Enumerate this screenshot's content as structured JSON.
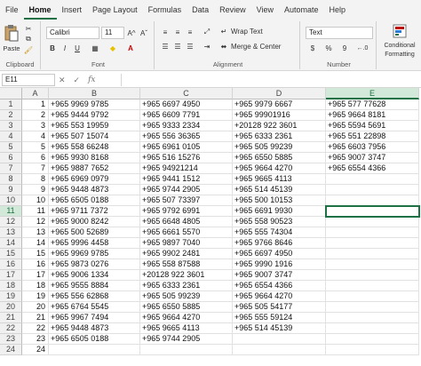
{
  "tabs": [
    "File",
    "Home",
    "Insert",
    "Page Layout",
    "Formulas",
    "Data",
    "Review",
    "View",
    "Automate",
    "Help"
  ],
  "active_tab": "Home",
  "ribbon": {
    "clipboard": {
      "paste": "Paste",
      "label": "Clipboard"
    },
    "font": {
      "name": "Calibri",
      "size": "11",
      "grow": "A^",
      "shrink": "Aˇ",
      "bold": "B",
      "italic": "I",
      "underline": "U",
      "label": "Font"
    },
    "alignment": {
      "wrap": "Wrap Text",
      "merge": "Merge & Center",
      "label": "Alignment"
    },
    "number": {
      "format": "Text",
      "currency": "$",
      "percent": "%",
      "comma": "9",
      "label": "Number"
    },
    "styles": {
      "conditional": "Conditional",
      "formatting": "Formatting"
    }
  },
  "formula_bar": {
    "name_box": "E11",
    "fx": "fx",
    "value": ""
  },
  "columns": [
    "A",
    "B",
    "C",
    "D",
    "E"
  ],
  "selected_column": "E",
  "selected_row": 11,
  "rows": [
    {
      "n": "1",
      "a": "1",
      "b": "+965 9969 9785",
      "c": "+965 6697 4950",
      "d": "+965 9979 6667",
      "e": "+965 577 77628"
    },
    {
      "n": "2",
      "a": "2",
      "b": "+965 9444 9792",
      "c": "+965 6609 7791",
      "d": "+965 99901916",
      "e": "+965 9664 8181"
    },
    {
      "n": "3",
      "a": "3",
      "b": "+965 553 19959",
      "c": "+965 9333 2334",
      "d": "+20128 922 3601",
      "e": "+965 5594 5691"
    },
    {
      "n": "4",
      "a": "4",
      "b": "+965 507 15074",
      "c": "+965 556 36365",
      "d": "+965 6333 2361",
      "e": "+965 551 22898"
    },
    {
      "n": "5",
      "a": "5",
      "b": "+965 558 66248",
      "c": "+965 6961 0105",
      "d": "+965 505 99239",
      "e": "+965 6603 7956"
    },
    {
      "n": "6",
      "a": "6",
      "b": "+965 9930 8168",
      "c": "+965 516 15276",
      "d": "+965 6550 5885",
      "e": "+965 9007 3747"
    },
    {
      "n": "7",
      "a": "7",
      "b": "+965 9887 7652",
      "c": "+965 94921214",
      "d": "+965 9664 4270",
      "e": "+965 6554 4366"
    },
    {
      "n": "8",
      "a": "8",
      "b": "+965 6969 0979",
      "c": "+965 9441 1512",
      "d": "+965 9665 4113",
      "e": ""
    },
    {
      "n": "9",
      "a": "9",
      "b": "+965 9448 4873",
      "c": "+965 9744 2905",
      "d": "+965 514 45139",
      "e": ""
    },
    {
      "n": "10",
      "a": "10",
      "b": "+965 6505 0188",
      "c": "+965 507 73397",
      "d": "+965 500 10153",
      "e": ""
    },
    {
      "n": "11",
      "a": "11",
      "b": "+965 9711 7372",
      "c": "+965 9792 6991",
      "d": "+965 6691 9930",
      "e": ""
    },
    {
      "n": "12",
      "a": "12",
      "b": "+965 9000 8242",
      "c": "+965 6648 4805",
      "d": "+965 558 90523",
      "e": ""
    },
    {
      "n": "13",
      "a": "13",
      "b": "+965 500 52689",
      "c": "+965 6661 5570",
      "d": "+965 555 74304",
      "e": ""
    },
    {
      "n": "14",
      "a": "14",
      "b": "+965 9996 4458",
      "c": "+965 9897 7040",
      "d": "+965 9766 8646",
      "e": ""
    },
    {
      "n": "15",
      "a": "15",
      "b": "+965 9969 9785",
      "c": "+965 9902 2481",
      "d": "+965 6697 4950",
      "e": ""
    },
    {
      "n": "16",
      "a": "16",
      "b": "+965 9873 0276",
      "c": "+965 558 87588",
      "d": "+965 9990 1916",
      "e": ""
    },
    {
      "n": "17",
      "a": "17",
      "b": "+965 9006 1334",
      "c": "+20128 922 3601",
      "d": "+965 9007 3747",
      "e": ""
    },
    {
      "n": "18",
      "a": "18",
      "b": "+965 9555 8884",
      "c": "+965 6333 2361",
      "d": "+965 6554 4366",
      "e": ""
    },
    {
      "n": "19",
      "a": "19",
      "b": "+965 556 62868",
      "c": "+965 505 99239",
      "d": "+965 9664 4270",
      "e": ""
    },
    {
      "n": "20",
      "a": "20",
      "b": "+965 6764 5545",
      "c": "+965 6550 5885",
      "d": "+965 505 54177",
      "e": ""
    },
    {
      "n": "21",
      "a": "21",
      "b": "+965 9967 7494",
      "c": "+965 9664 4270",
      "d": "+965 555 59124",
      "e": ""
    },
    {
      "n": "22",
      "a": "22",
      "b": "+965 9448 4873",
      "c": "+965 9665 4113",
      "d": "+965 514 45139",
      "e": ""
    },
    {
      "n": "23",
      "a": "23",
      "b": "+965 6505 0188",
      "c": "+965 9744 2905",
      "d": "",
      "e": ""
    },
    {
      "n": "24",
      "a": "24",
      "b": "",
      "c": "",
      "d": "",
      "e": ""
    }
  ]
}
